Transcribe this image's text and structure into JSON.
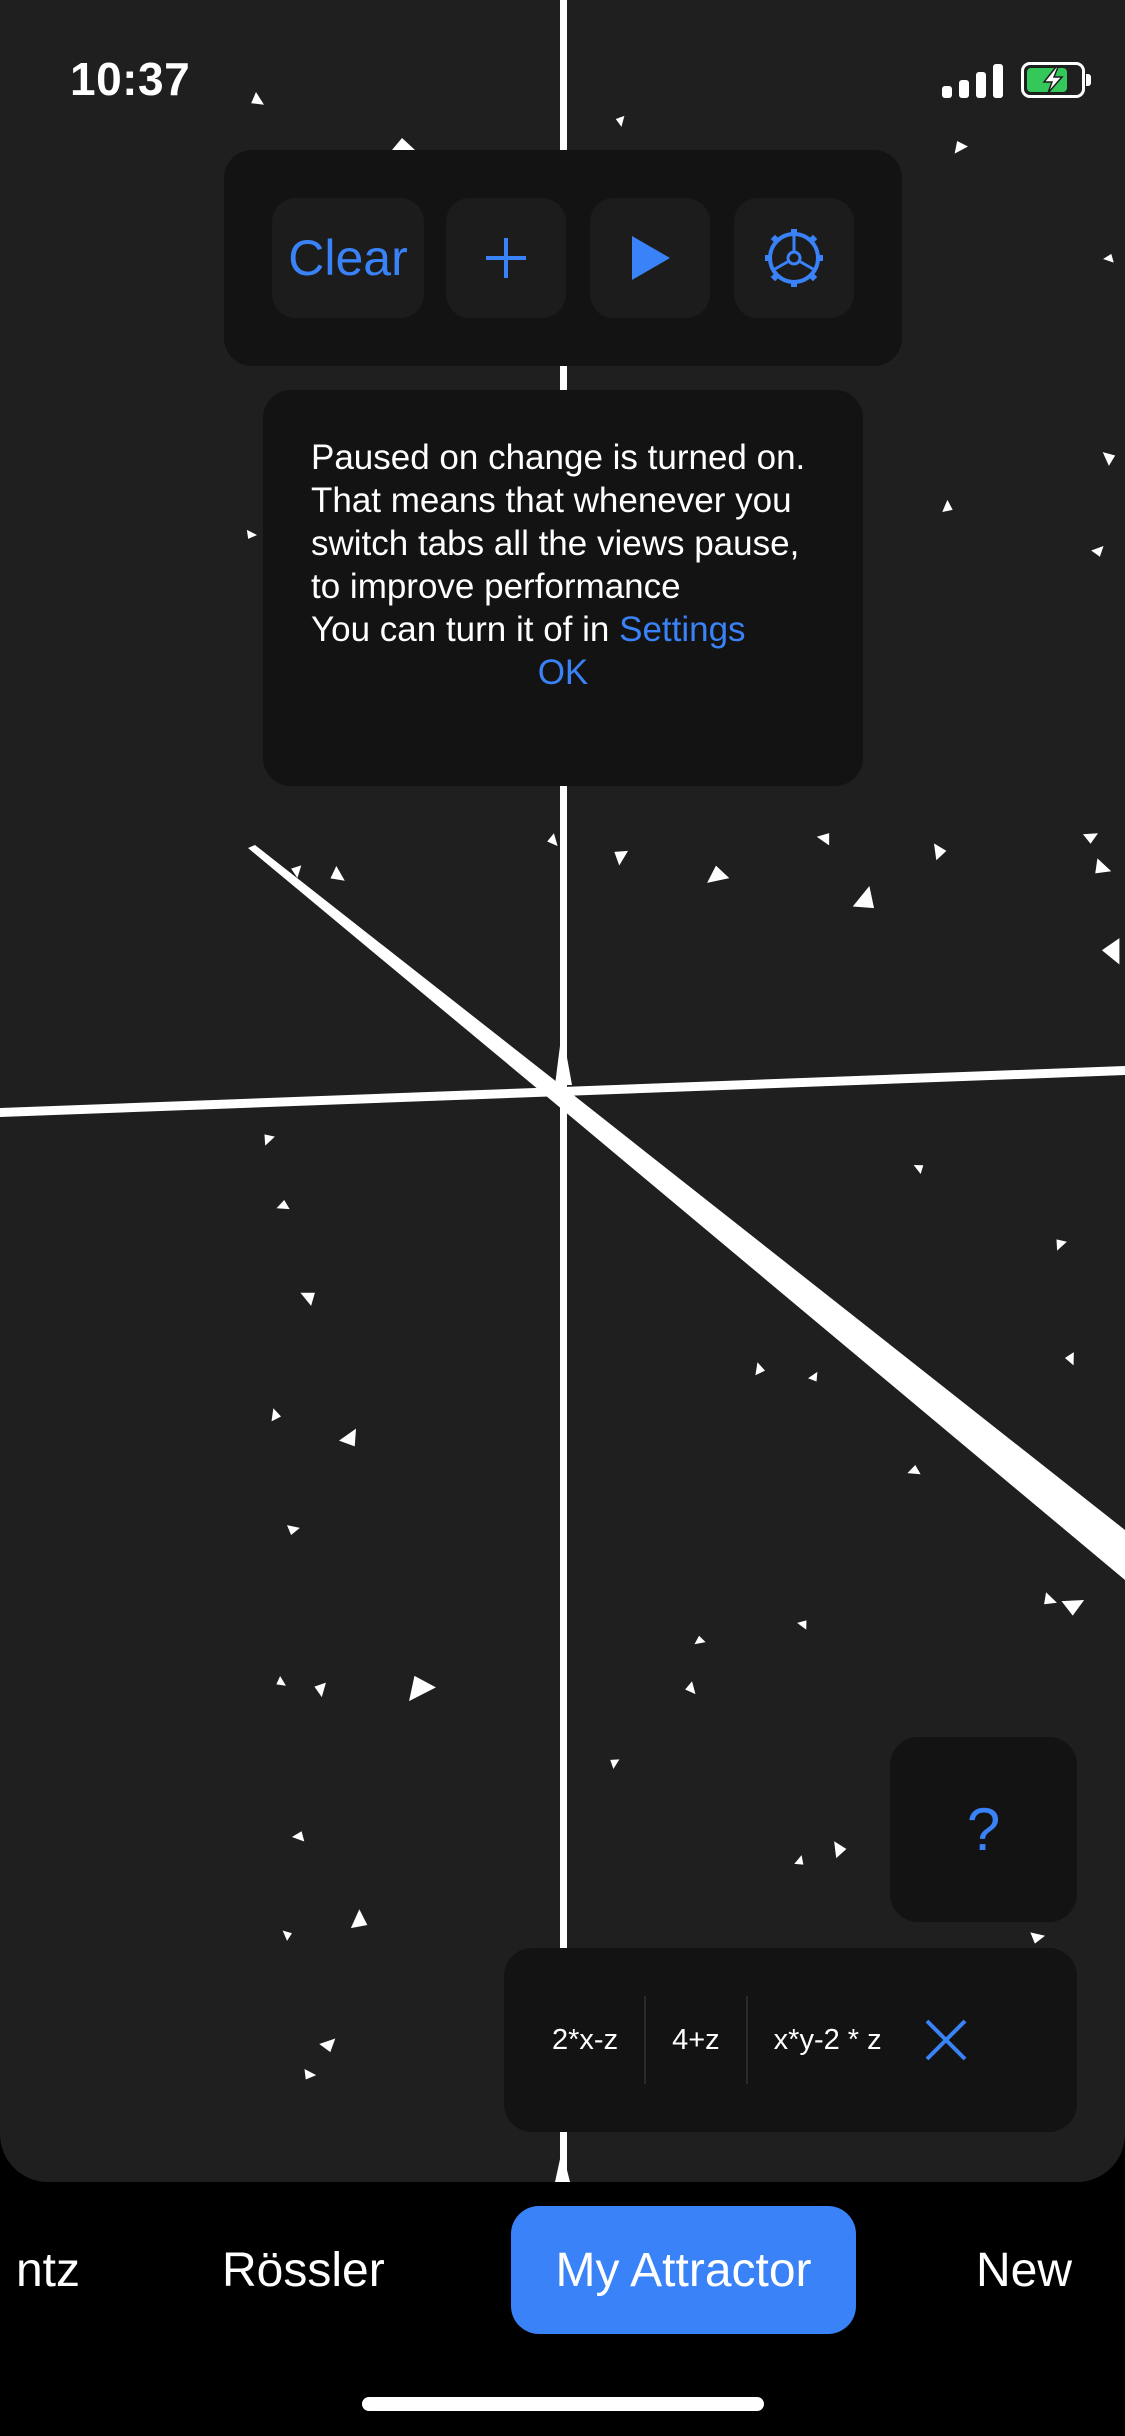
{
  "status_bar": {
    "time": "10:37"
  },
  "toolbar": {
    "clear_label": "Clear",
    "add_icon": "plus-icon",
    "play_icon": "play-icon",
    "settings_icon": "gear-icon"
  },
  "notice": {
    "text": "Paused on change is turned on. That means that whenever you switch tabs all the views pause, to improve performance",
    "line2_prefix": "You can turn it of in",
    "settings_link": "Settings",
    "ok_label": "OK"
  },
  "help": {
    "label": "?"
  },
  "equations": {
    "items": [
      "2*x-z",
      "4+z",
      "x*y-2 * z"
    ],
    "close_icon": "close-icon"
  },
  "tabs": {
    "items": [
      "Lorentz",
      "Rössler",
      "My Attractor",
      "New"
    ],
    "visible_first": "ntz",
    "active": "My Attractor"
  },
  "colors": {
    "accent": "#3a82f7",
    "background": "#1f1f1f",
    "panel": "#131313",
    "battery": "#34c759"
  }
}
